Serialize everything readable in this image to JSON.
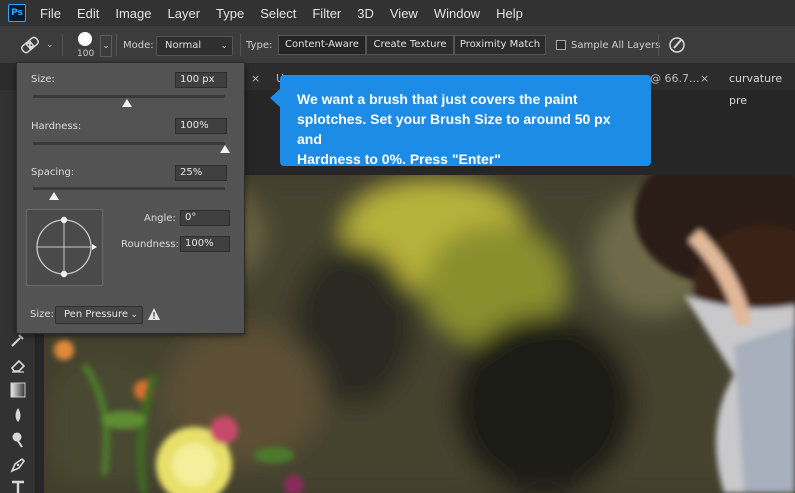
{
  "app": {
    "logo_text": "Ps"
  },
  "menu": [
    "File",
    "Edit",
    "Image",
    "Layer",
    "Type",
    "Select",
    "Filter",
    "3D",
    "View",
    "Window",
    "Help"
  ],
  "options_bar": {
    "brush_size_value": "100",
    "mode_label": "Mode:",
    "mode_value": "Normal",
    "type_label": "Type:",
    "type_options": [
      "Content-Aware",
      "Create Texture",
      "Proximity Match"
    ],
    "type_selected": "Content-Aware",
    "sample_all_layers_label": "Sample All Layers",
    "sample_all_layers_checked": false
  },
  "tabs": {
    "partial_tab_left": "U",
    "partial_tab_zoom": "@ 66.7...",
    "tab_right": "curvature pre",
    "close_glyph": "×"
  },
  "brush_panel": {
    "size_label": "Size:",
    "size_value": "100 px",
    "size_slider_fraction": 0.49,
    "hardness_label": "Hardness:",
    "hardness_value": "100%",
    "hardness_slider_fraction": 1.0,
    "spacing_label": "Spacing:",
    "spacing_value": "25%",
    "spacing_slider_fraction": 0.11,
    "angle_label": "Angle:",
    "angle_value": "0°",
    "roundness_label": "Roundness:",
    "roundness_value": "100%",
    "size_control_label": "Size:",
    "size_control_value": "Pen Pressure"
  },
  "tooltip": {
    "lines": [
      "We want a brush that just covers the paint",
      "splotches. Set your Brush Size to around 50 px and",
      "Hardness to 0%. Press \"Enter\""
    ]
  },
  "colors": {
    "accent": "#1c8ce6",
    "panel_bg": "#535353",
    "menubar_bg": "#323232",
    "optbar_bg": "#3c3c3c"
  }
}
